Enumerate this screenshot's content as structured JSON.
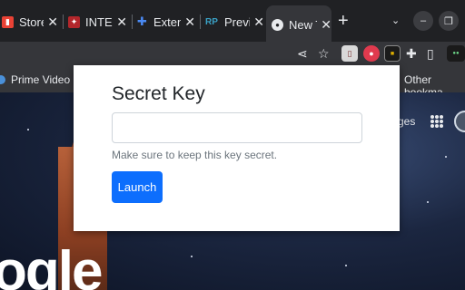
{
  "tabs": [
    {
      "title": "Store",
      "favicon": "store-favicon",
      "color": "#e94235"
    },
    {
      "title": "INTEN",
      "favicon": "shield-favicon",
      "color": "#b3262b"
    },
    {
      "title": "Extens",
      "favicon": "puzzle-favicon",
      "color": "#4a8af4"
    },
    {
      "title": "Previe",
      "favicon": "rp-favicon",
      "color": "#3aa2c6"
    },
    {
      "title": "New T",
      "favicon": "chrome-favicon",
      "color": "#e8eaed",
      "active": true
    }
  ],
  "tab_close_glyph": "✕",
  "new_tab_glyph": "+",
  "bookmarks": {
    "prime_video": "Prime Video",
    "other_bookmarks": "Other bookma"
  },
  "new_tab_page": {
    "images_link_partial": "ges",
    "google_logo_partial": "ogle"
  },
  "popup": {
    "title": "Secret Key",
    "input_value": "",
    "input_placeholder": "",
    "help_text": "Make sure to keep this key secret.",
    "launch_label": "Launch"
  },
  "colors": {
    "primary": "#0d6efd",
    "chrome_dark": "#202124",
    "toolbar": "#35363a"
  }
}
